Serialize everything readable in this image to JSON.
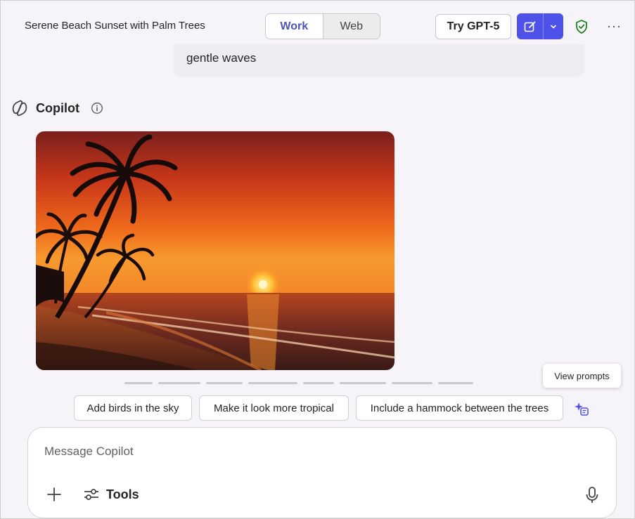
{
  "header": {
    "title": "Serene Beach Sunset with Palm Trees",
    "mode_tabs": [
      {
        "label": "Work",
        "active": true
      },
      {
        "label": "Web",
        "active": false
      }
    ],
    "try_button": "Try GPT-5",
    "icons": {
      "new_chat": "compose-icon",
      "dropdown": "chevron-down-icon",
      "protection": "shield-check-icon",
      "more": "more-horizontal-icon"
    },
    "more_label": "···"
  },
  "user_message": {
    "text_visible": "gentle waves"
  },
  "response": {
    "assistant_name": "Copilot",
    "info_icon": "info-icon",
    "image_subject": "palm-trees-beach-sunset-image"
  },
  "suggestions": {
    "tooltip": "View prompts",
    "chips": [
      "Add birds in the sky",
      "Make it look more tropical",
      "Include a hammock between the trees"
    ]
  },
  "composer": {
    "placeholder": "Message Copilot",
    "tools_label": "Tools",
    "icons": {
      "add": "plus-icon",
      "tools": "sliders-icon",
      "mic": "microphone-icon"
    }
  },
  "colors": {
    "accent": "#4f52e8",
    "accent_text": "#4f52b2",
    "shield": "#107c10",
    "background": "#f7f4f9"
  }
}
